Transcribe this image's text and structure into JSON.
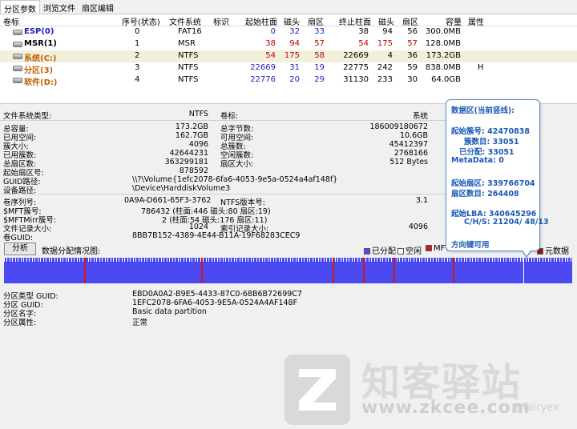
{
  "tabs": [
    "分区参数",
    "浏览文件",
    "扇区编辑"
  ],
  "table": {
    "headers": [
      "卷标",
      "序号(状态)",
      "文件系统",
      "标识",
      "起始柱面",
      "磁头",
      "扇区",
      "终止柱面",
      "磁头",
      "扇区",
      "容量",
      "属性"
    ],
    "rows": [
      {
        "name": "ESP(0)",
        "index": "0",
        "fs": "FAT16",
        "flag": "",
        "start_cyl": "0",
        "start_head": "32",
        "start_sec": "33",
        "end_cyl": "38",
        "end_head": "94",
        "end_sec": "56",
        "size": "300.0MB",
        "attr": ""
      },
      {
        "name": "MSR(1)",
        "index": "1",
        "fs": "MSR",
        "flag": "",
        "start_cyl": "38",
        "start_head": "94",
        "start_sec": "57",
        "end_cyl": "54",
        "end_head": "175",
        "end_sec": "57",
        "size": "128.0MB",
        "attr": ""
      },
      {
        "name": "系统(C:)",
        "index": "2",
        "fs": "NTFS",
        "flag": "",
        "start_cyl": "54",
        "start_head": "175",
        "start_sec": "58",
        "end_cyl": "22669",
        "end_head": "4",
        "end_sec": "36",
        "size": "173.2GB",
        "attr": ""
      },
      {
        "name": "分区(3)",
        "index": "3",
        "fs": "NTFS",
        "flag": "",
        "start_cyl": "22669",
        "start_head": "31",
        "start_sec": "19",
        "end_cyl": "22775",
        "end_head": "242",
        "end_sec": "59",
        "size": "838.0MB",
        "attr": "H"
      },
      {
        "name": "软件(D:)",
        "index": "4",
        "fs": "NTFS",
        "flag": "",
        "start_cyl": "22776",
        "start_head": "20",
        "start_sec": "29",
        "end_cyl": "31130",
        "end_head": "233",
        "end_sec": "30",
        "size": "64.0GB",
        "attr": ""
      }
    ]
  },
  "info": {
    "fs_type_label": "文件系统类型:",
    "fs_type": "NTFS",
    "vol_label_label": "卷标:",
    "vol_label": "系统",
    "total_label": "总容量:",
    "total": "173.2GB",
    "total_bytes_label": "总字节数:",
    "total_bytes": "186009180672",
    "used_label": "已用空间:",
    "used": "162.7GB",
    "free_label": "可用空间:",
    "free": "10.6GB",
    "cluster_label": "簇大小:",
    "cluster": "4096",
    "clusters_label": "总簇数:",
    "clusters": "45412397",
    "used_clusters_label": "已用簇数:",
    "used_clusters": "42644231",
    "free_clusters_label": "空闲簇数:",
    "free_clusters": "2768166",
    "sectors_label": "总扇区数:",
    "sectors": "363299181",
    "sector_size_label": "扇区大小:",
    "sector_size": "512 Bytes",
    "start_sector_label": "起始扇区号:",
    "start_sector": "878592",
    "guid_path_label": "GUID路径:",
    "guid_path": "\\\\?\\Volume{1efc2078-6fa6-4053-9e5a-0524a4af148f}",
    "device_path_label": "设备路径:",
    "device_path": "\\Device\\HarddiskVolume3",
    "serial_label": "卷序列号:",
    "serial": "0A9A-D661-65F3-3762",
    "ntfs_ver_label": "NTFS版本号:",
    "ntfs_ver": "3.1",
    "mft_label": "$MFT簇号:",
    "mft": "786432 (柱面:446 磁头:80 扇区:19)",
    "mftmirr_label": "$MFTMirr簇号:",
    "mftmirr": "2 (柱面:54 磁头:176 扇区:11)",
    "frs_label": "文件记录大小:",
    "frs": "1024",
    "irs_label": "索引记录大小:",
    "irs": "4096",
    "vol_guid_label": "卷GUID:",
    "vol_guid": "8BB7B152-4389-4E44-B11A-19F68283CEC9"
  },
  "map": {
    "button": "分析",
    "label": "数据分配情况图:",
    "legend": [
      "已分配",
      "空闲",
      "MFT",
      "元数据"
    ],
    "colors": {
      "allocated": "#4a4af0",
      "free": "#ffffff",
      "mft": "#d01818",
      "meta": "#a01010"
    }
  },
  "guid": {
    "type_label": "分区类型 GUID:",
    "type": "EBD0A0A2-B9E5-4433-87C0-68B6B72699C7",
    "part_label": "分区 GUID:",
    "part": "1EFC2078-6FA6-4053-9E5A-0524A4AF148F",
    "name_label": "分区名字:",
    "name": "Basic data partition",
    "attr_label": "分区属性:",
    "attr": "正常"
  },
  "popup": {
    "title": "数据区(当前竖线):",
    "start_cluster": "起始簇号: 42470838",
    "cluster_count": "簇数目: 33051",
    "allocated": "已分配: 33051",
    "metadata": "MetaData: 0",
    "start_sector": "起始扇区: 339766704",
    "sector_count": "扇区数目: 264408",
    "start_lba": "起始LBA: 340645296",
    "chs": "C/H/S: 21204/ 48/13",
    "hint": "方向键可用"
  },
  "watermark": {
    "brand": "知客驿站",
    "url": "www.zkcee.com",
    "handle": "@fairyex"
  }
}
